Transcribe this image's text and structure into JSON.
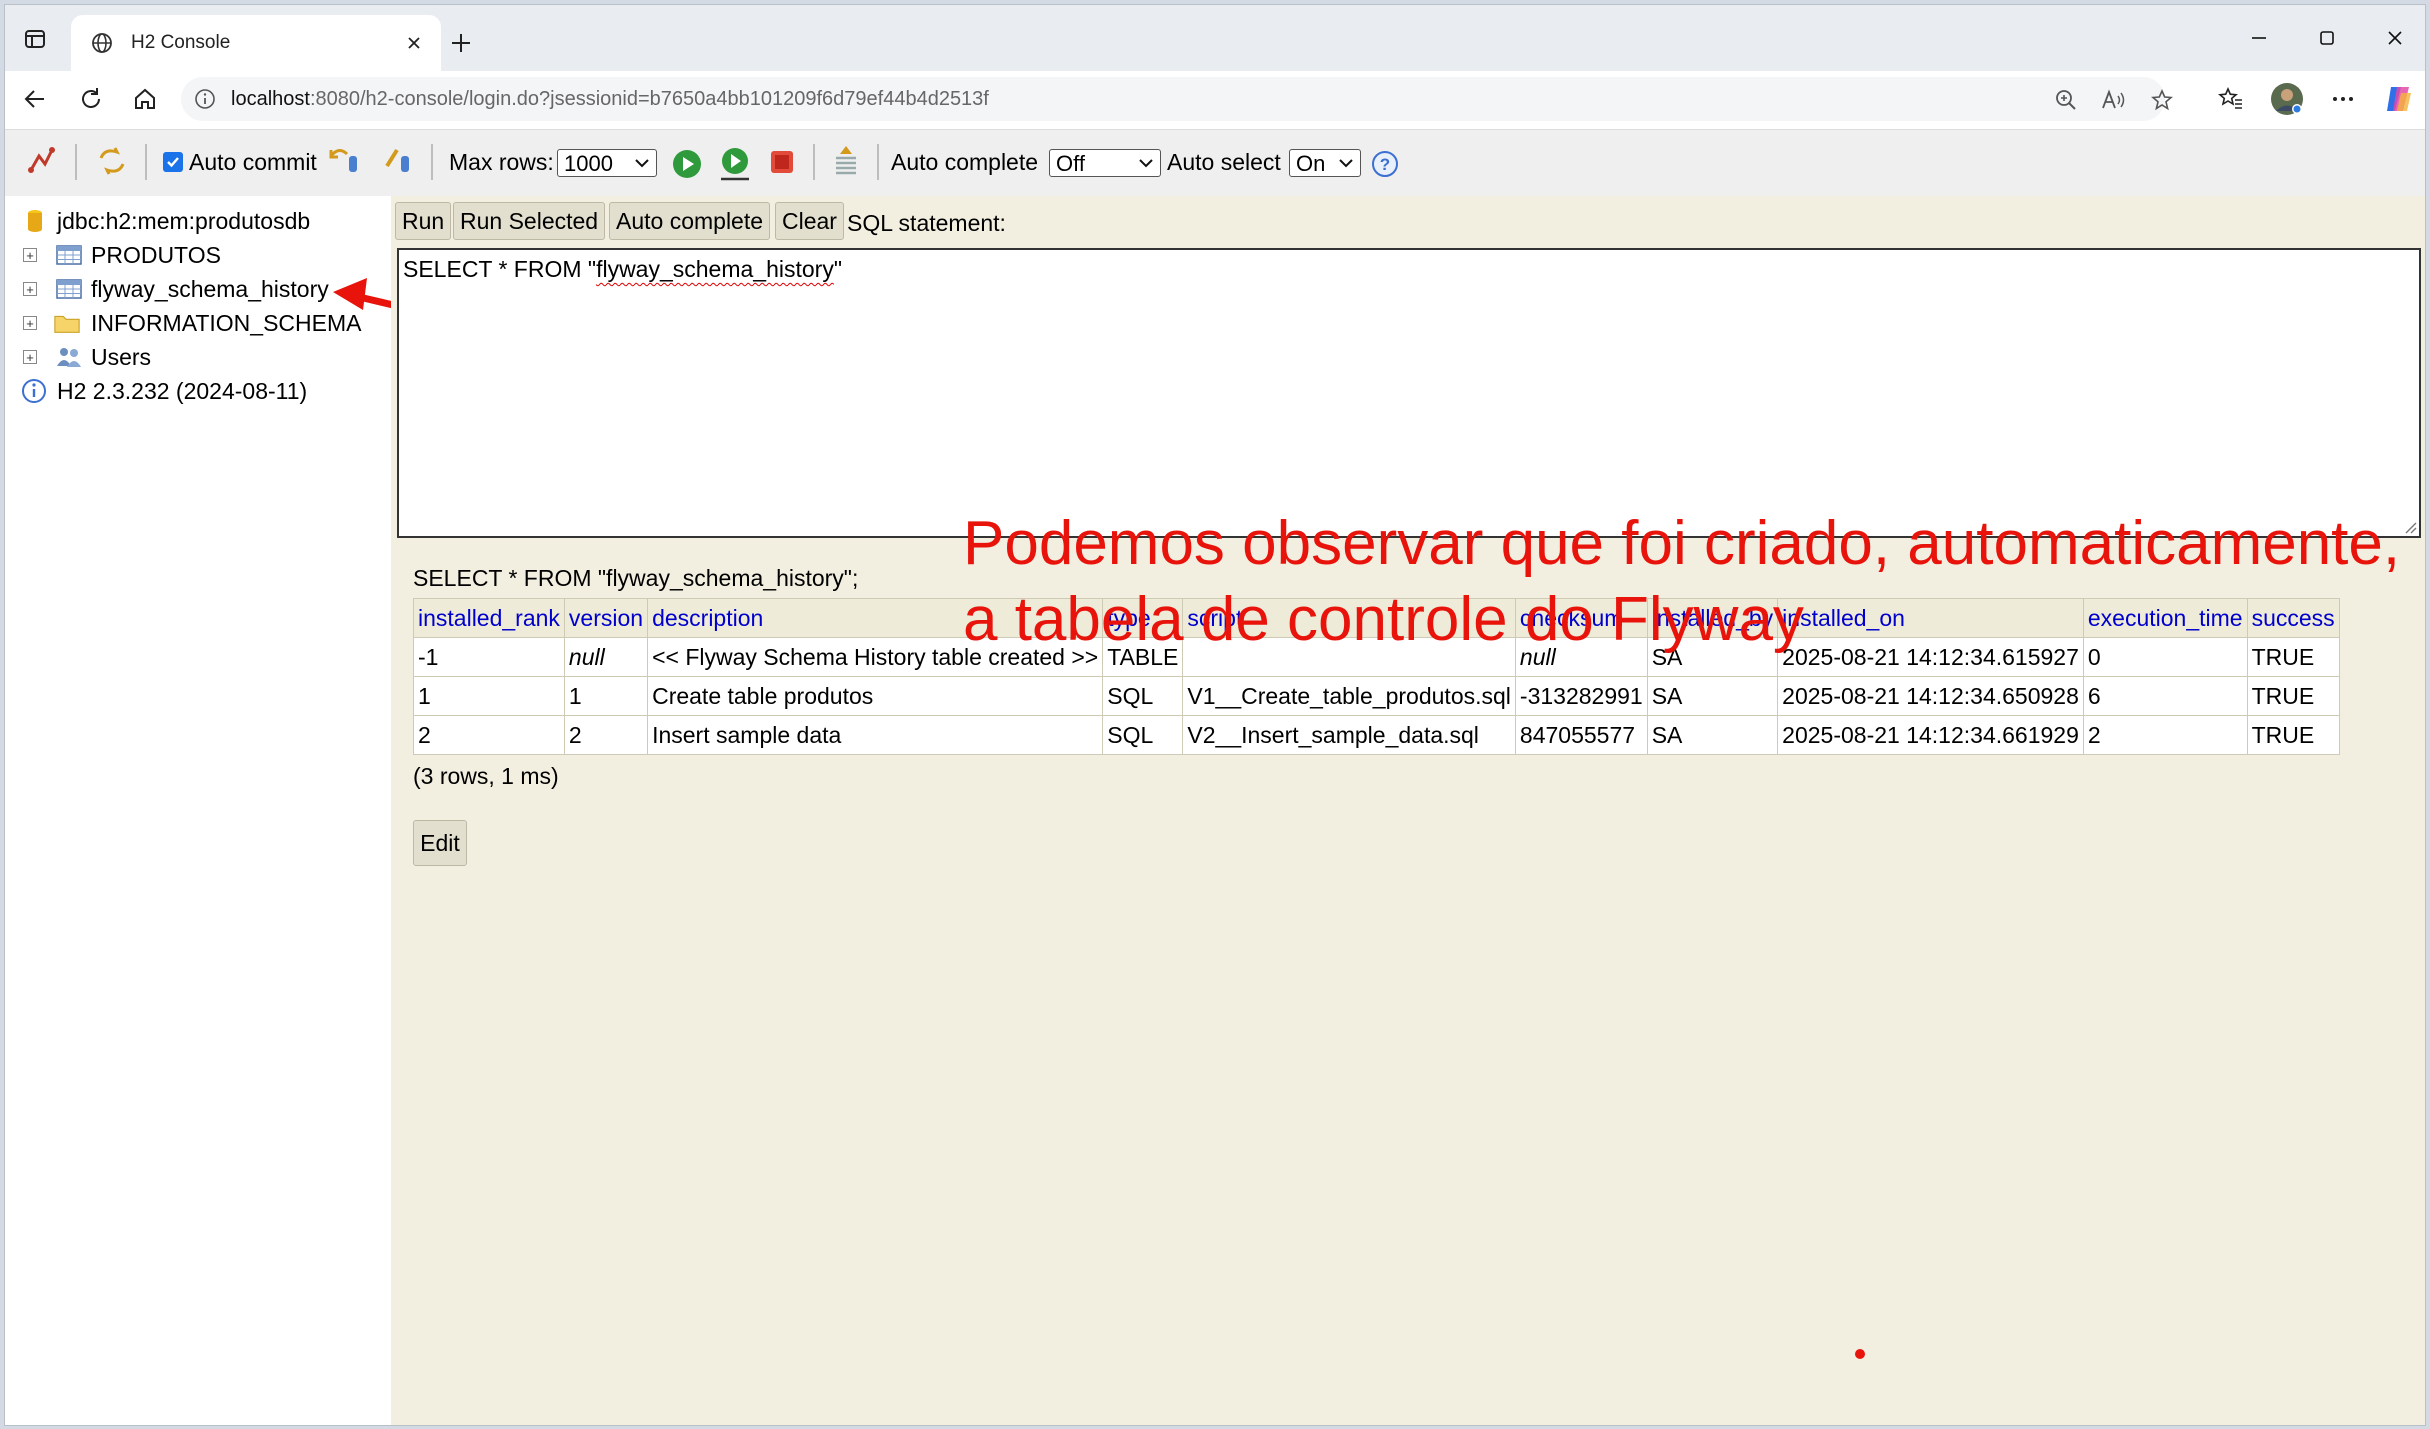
{
  "browser": {
    "tab_title": "H2 Console",
    "url_host": "localhost",
    "url_rest": ":8080/h2-console/login.do?jsessionid=b7650a4bb101209f6d79ef44b4d2513f"
  },
  "toolbar": {
    "auto_commit_label": "Auto commit",
    "auto_commit_checked": true,
    "max_rows_label": "Max rows:",
    "max_rows_value": "1000",
    "auto_complete_label": "Auto complete",
    "auto_complete_value": "Off",
    "auto_select_label": "Auto select",
    "auto_select_value": "On"
  },
  "tree": {
    "connection": "jdbc:h2:mem:produtosdb",
    "items": [
      {
        "label": "PRODUTOS",
        "icon": "table-icon"
      },
      {
        "label": "flyway_schema_history",
        "icon": "table-icon"
      },
      {
        "label": "INFORMATION_SCHEMA",
        "icon": "folder-icon"
      },
      {
        "label": "Users",
        "icon": "users-icon"
      }
    ],
    "version": "H2 2.3.232 (2024-08-11)"
  },
  "query": {
    "run_label": "Run",
    "run_selected_label": "Run Selected",
    "auto_complete_label": "Auto complete",
    "clear_label": "Clear",
    "sql_label": "SQL statement:",
    "sql_prefix": "SELECT * FROM \"",
    "sql_table": "flyway_schema_history",
    "sql_suffix": "\""
  },
  "result": {
    "echo": "SELECT * FROM \"flyway_schema_history\";",
    "columns": [
      "installed_rank",
      "version",
      "description",
      "type",
      "script",
      "checksum",
      "installed_by",
      "installed_on",
      "execution_time",
      "success"
    ],
    "rows": [
      [
        "-1",
        "null",
        "<< Flyway Schema History table created >>",
        "TABLE",
        "",
        "null",
        "SA",
        "2025-08-21 14:12:34.615927",
        "0",
        "TRUE"
      ],
      [
        "1",
        "1",
        "Create table produtos",
        "SQL",
        "V1__Create_table_produtos.sql",
        "-313282991",
        "SA",
        "2025-08-21 14:12:34.650928",
        "6",
        "TRUE"
      ],
      [
        "2",
        "2",
        "Insert sample data",
        "SQL",
        "V2__Insert_sample_data.sql",
        "847055577",
        "SA",
        "2025-08-21 14:12:34.661929",
        "2",
        "TRUE"
      ]
    ],
    "row_count": "(3 rows, 1 ms)",
    "edit_label": "Edit"
  },
  "annotation": {
    "line1": "Podemos observar que foi criado, automaticamente,",
    "line2": "a tabela de controle do Flyway",
    "color": "#e8140c"
  }
}
